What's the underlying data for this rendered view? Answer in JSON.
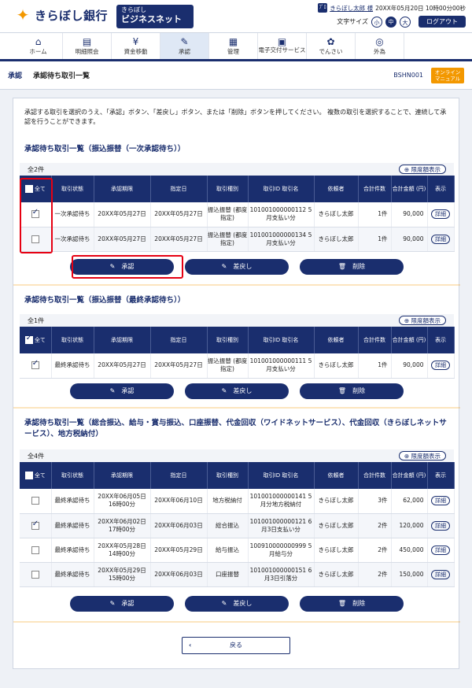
{
  "header": {
    "bank_name": "きらぼし銀行",
    "service_small": "きらぼし",
    "service_big": "ビジネスネット",
    "user_icon": "ﾌﾟﾛ",
    "user_name": "きらぼし太郎 様",
    "datetime": "20XX年05月20日 10時00分00秒",
    "font_size_label": "文字サイズ",
    "font_small": "小",
    "font_medium": "中",
    "font_large": "大",
    "logout": "ログアウト"
  },
  "nav": [
    {
      "label": "ホーム",
      "icon": "home-icon",
      "glyph": "⌂"
    },
    {
      "label": "明細照会",
      "icon": "document-icon",
      "glyph": "▤"
    },
    {
      "label": "資金移動",
      "icon": "yen-icon",
      "glyph": "¥"
    },
    {
      "label": "承認",
      "icon": "approve-icon",
      "glyph": "✎"
    },
    {
      "label": "管理",
      "icon": "manage-icon",
      "glyph": "▦"
    },
    {
      "label": "電子交付サービス",
      "icon": "delivery-icon",
      "glyph": "▣"
    },
    {
      "label": "でんさい",
      "icon": "densai-icon",
      "glyph": "✿"
    },
    {
      "label": "外為",
      "icon": "forex-icon",
      "glyph": "◎"
    }
  ],
  "subhead": {
    "crumb1": "承認",
    "crumb2": "承認待ち取引一覧",
    "screen_id": "BSHN001",
    "manual": "オンライン マニュアル"
  },
  "intro": "承認する取引を選択のうえ、「承認」ボタン、「差戻し」ボタン、または「削除」ボタンを押してください。 複数の取引を選択することで、連続して承認を行うことができます。",
  "columns": [
    "全て",
    "取引状態",
    "承認期限",
    "指定日",
    "取引種別",
    "取引ID 取引名",
    "依頼者",
    "合計件数",
    "合計金額 (円)",
    "表示"
  ],
  "limit_label": "限度額表示",
  "detail_label": "詳細",
  "buttons": {
    "approve": "承認",
    "return": "差戻し",
    "delete": "削除"
  },
  "back": "戻る",
  "sections": [
    {
      "title": "承認待ち取引一覧（振込振替（一次承認待ち））",
      "count": "全2件",
      "rows": [
        {
          "checked": true,
          "status": "一次承認待ち",
          "deadline": "20XX年05月27日",
          "date": "20XX年05月27日",
          "type": "振込振替 (都度指定)",
          "id": "101001000000112 5月支払い分",
          "requester": "きらぼし太郎",
          "cnt": "1件",
          "amount": "90,000"
        },
        {
          "checked": false,
          "status": "一次承認待ち",
          "deadline": "20XX年05月27日",
          "date": "20XX年05月27日",
          "type": "振込振替 (都度指定)",
          "id": "101001000000134 5月支払い分",
          "requester": "きらぼし太郎",
          "cnt": "1件",
          "amount": "90,000"
        }
      ]
    },
    {
      "title": "承認待ち取引一覧（振込振替（最終承認待ち））",
      "count": "全1件",
      "rows": [
        {
          "checked": true,
          "status": "最終承認待ち",
          "deadline": "20XX年05月27日",
          "date": "20XX年05月27日",
          "type": "振込振替 (都度指定)",
          "id": "101001000000111 5月支払い分",
          "requester": "きらぼし太郎",
          "cnt": "1件",
          "amount": "90,000"
        }
      ]
    },
    {
      "title": "承認待ち取引一覧（総合振込、給与・賞与振込、口座振替、代金回収（ワイドネットサービス）、代金回収（きらぼしネットサービス）、地方税納付）",
      "count": "全4件",
      "rows": [
        {
          "checked": false,
          "status": "最終承認待ち",
          "deadline": "20XX年06月05日 16時00分",
          "date": "20XX年06月10日",
          "type": "地方税納付",
          "id": "101001000000141 5月分地方税納付",
          "requester": "きらぼし太郎",
          "cnt": "3件",
          "amount": "62,000"
        },
        {
          "checked": true,
          "status": "最終承認待ち",
          "deadline": "20XX年06月02日 17時00分",
          "date": "20XX年06月03日",
          "type": "総合振込",
          "id": "101001000000121 6月3日支払い分",
          "requester": "きらぼし太郎",
          "cnt": "2件",
          "amount": "120,000"
        },
        {
          "checked": false,
          "status": "最終承認待ち",
          "deadline": "20XX年05月28日 14時00分",
          "date": "20XX年05月29日",
          "type": "給与振込",
          "id": "100910000000999 5月給与分",
          "requester": "きらぼし太郎",
          "cnt": "2件",
          "amount": "450,000"
        },
        {
          "checked": false,
          "status": "最終承認待ち",
          "deadline": "20XX年05月29日 15時00分",
          "date": "20XX年06月03日",
          "type": "口座振替",
          "id": "101001000000151 6月3日引落分",
          "requester": "きらぼし太郎",
          "cnt": "2件",
          "amount": "150,000"
        }
      ]
    }
  ]
}
